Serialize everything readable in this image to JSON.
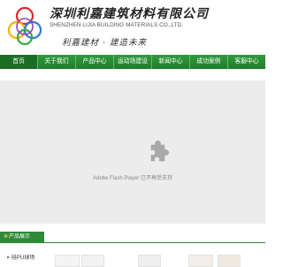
{
  "header": {
    "company_name_cn": "深圳利嘉建筑材料有限公司",
    "company_name_en": "SHENZHEN LIJIA BUILDING MATERIALS CO.,LTD.",
    "slogan": "利嘉建材 · 建造未来"
  },
  "nav": {
    "items": [
      "首页",
      "关于我们",
      "产品中心",
      "运动场建设",
      "新闻中心",
      "成功案例",
      "客服中心"
    ]
  },
  "banner": {
    "plugin_message": "Adobe Flash Player 已不再受支持",
    "plugin_icon": "puzzle-piece-icon"
  },
  "products": {
    "title": "产品展示",
    "category": "硅PU球场"
  },
  "colors": {
    "nav_green": "#2f9a3d",
    "accent_green": "#2e8a36",
    "plugin_bg": "#ececec"
  }
}
